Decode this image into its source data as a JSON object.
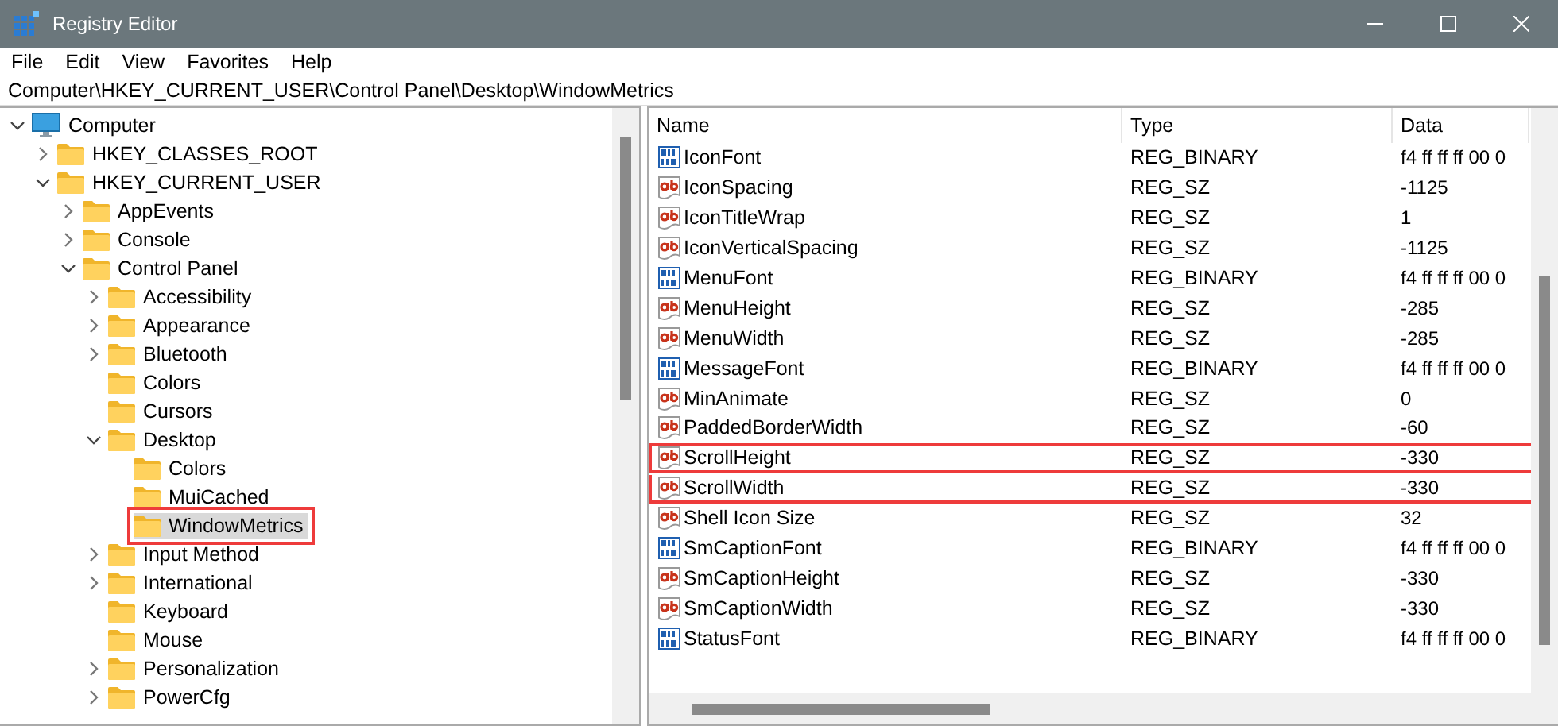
{
  "window": {
    "title": "Registry Editor"
  },
  "menu": [
    "File",
    "Edit",
    "View",
    "Favorites",
    "Help"
  ],
  "address": "Computer\\HKEY_CURRENT_USER\\Control Panel\\Desktop\\WindowMetrics",
  "tree": [
    {
      "label": "Computer",
      "kind": "computer",
      "expanded": true,
      "selected": false,
      "annotated": false,
      "children": [
        {
          "label": "HKEY_CLASSES_ROOT",
          "kind": "folder",
          "expanded": false,
          "selected": false,
          "annotated": false
        },
        {
          "label": "HKEY_CURRENT_USER",
          "kind": "folder",
          "expanded": true,
          "selected": false,
          "annotated": false,
          "children": [
            {
              "label": "AppEvents",
              "kind": "folder",
              "expanded": false,
              "selected": false,
              "annotated": false
            },
            {
              "label": "Console",
              "kind": "folder",
              "expanded": false,
              "selected": false,
              "annotated": false
            },
            {
              "label": "Control Panel",
              "kind": "folder",
              "expanded": true,
              "selected": false,
              "annotated": false,
              "children": [
                {
                  "label": "Accessibility",
                  "kind": "folder",
                  "expanded": false,
                  "selected": false,
                  "annotated": false
                },
                {
                  "label": "Appearance",
                  "kind": "folder",
                  "expanded": false,
                  "selected": false,
                  "annotated": false
                },
                {
                  "label": "Bluetooth",
                  "kind": "folder",
                  "expanded": false,
                  "selected": false,
                  "annotated": false
                },
                {
                  "label": "Colors",
                  "kind": "folder",
                  "selected": false,
                  "annotated": false
                },
                {
                  "label": "Cursors",
                  "kind": "folder",
                  "selected": false,
                  "annotated": false
                },
                {
                  "label": "Desktop",
                  "kind": "folder",
                  "expanded": true,
                  "selected": false,
                  "annotated": false,
                  "children": [
                    {
                      "label": "Colors",
                      "kind": "folder",
                      "selected": false,
                      "annotated": false
                    },
                    {
                      "label": "MuiCached",
                      "kind": "folder",
                      "selected": false,
                      "annotated": false
                    },
                    {
                      "label": "WindowMetrics",
                      "kind": "folder",
                      "selected": true,
                      "annotated": true
                    }
                  ]
                },
                {
                  "label": "Input Method",
                  "kind": "folder",
                  "expanded": false,
                  "selected": false,
                  "annotated": false
                },
                {
                  "label": "International",
                  "kind": "folder",
                  "expanded": false,
                  "selected": false,
                  "annotated": false
                },
                {
                  "label": "Keyboard",
                  "kind": "folder",
                  "selected": false,
                  "annotated": false
                },
                {
                  "label": "Mouse",
                  "kind": "folder",
                  "selected": false,
                  "annotated": false
                },
                {
                  "label": "Personalization",
                  "kind": "folder",
                  "expanded": false,
                  "selected": false,
                  "annotated": false
                },
                {
                  "label": "PowerCfg",
                  "kind": "folder",
                  "expanded": false,
                  "selected": false,
                  "annotated": false
                }
              ]
            }
          ]
        }
      ]
    }
  ],
  "columns": [
    "Name",
    "Type",
    "Data"
  ],
  "rows": [
    {
      "kind": "binary",
      "name": "IconFont",
      "type": "REG_BINARY",
      "data": "f4 ff ff ff 00 0",
      "annotated": false
    },
    {
      "kind": "string",
      "name": "IconSpacing",
      "type": "REG_SZ",
      "data": "-1125",
      "annotated": false
    },
    {
      "kind": "string",
      "name": "IconTitleWrap",
      "type": "REG_SZ",
      "data": "1",
      "annotated": false
    },
    {
      "kind": "string",
      "name": "IconVerticalSpacing",
      "type": "REG_SZ",
      "data": "-1125",
      "annotated": false
    },
    {
      "kind": "binary",
      "name": "MenuFont",
      "type": "REG_BINARY",
      "data": "f4 ff ff ff 00 0",
      "annotated": false
    },
    {
      "kind": "string",
      "name": "MenuHeight",
      "type": "REG_SZ",
      "data": "-285",
      "annotated": false
    },
    {
      "kind": "string",
      "name": "MenuWidth",
      "type": "REG_SZ",
      "data": "-285",
      "annotated": false
    },
    {
      "kind": "binary",
      "name": "MessageFont",
      "type": "REG_BINARY",
      "data": "f4 ff ff ff 00 0",
      "annotated": false
    },
    {
      "kind": "string",
      "name": "MinAnimate",
      "type": "REG_SZ",
      "data": "0",
      "annotated": false
    },
    {
      "kind": "string",
      "name": "PaddedBorderWidth",
      "type": "REG_SZ",
      "data": "-60",
      "annotated": false
    },
    {
      "kind": "string",
      "name": "ScrollHeight",
      "type": "REG_SZ",
      "data": "-330",
      "annotated": true
    },
    {
      "kind": "string",
      "name": "ScrollWidth",
      "type": "REG_SZ",
      "data": "-330",
      "annotated": true
    },
    {
      "kind": "string",
      "name": "Shell Icon Size",
      "type": "REG_SZ",
      "data": "32",
      "annotated": false
    },
    {
      "kind": "binary",
      "name": "SmCaptionFont",
      "type": "REG_BINARY",
      "data": "f4 ff ff ff 00 0",
      "annotated": false
    },
    {
      "kind": "string",
      "name": "SmCaptionHeight",
      "type": "REG_SZ",
      "data": "-330",
      "annotated": false
    },
    {
      "kind": "string",
      "name": "SmCaptionWidth",
      "type": "REG_SZ",
      "data": "-330",
      "annotated": false
    },
    {
      "kind": "binary",
      "name": "StatusFont",
      "type": "REG_BINARY",
      "data": "f4 ff ff ff 00 0",
      "annotated": false
    }
  ]
}
